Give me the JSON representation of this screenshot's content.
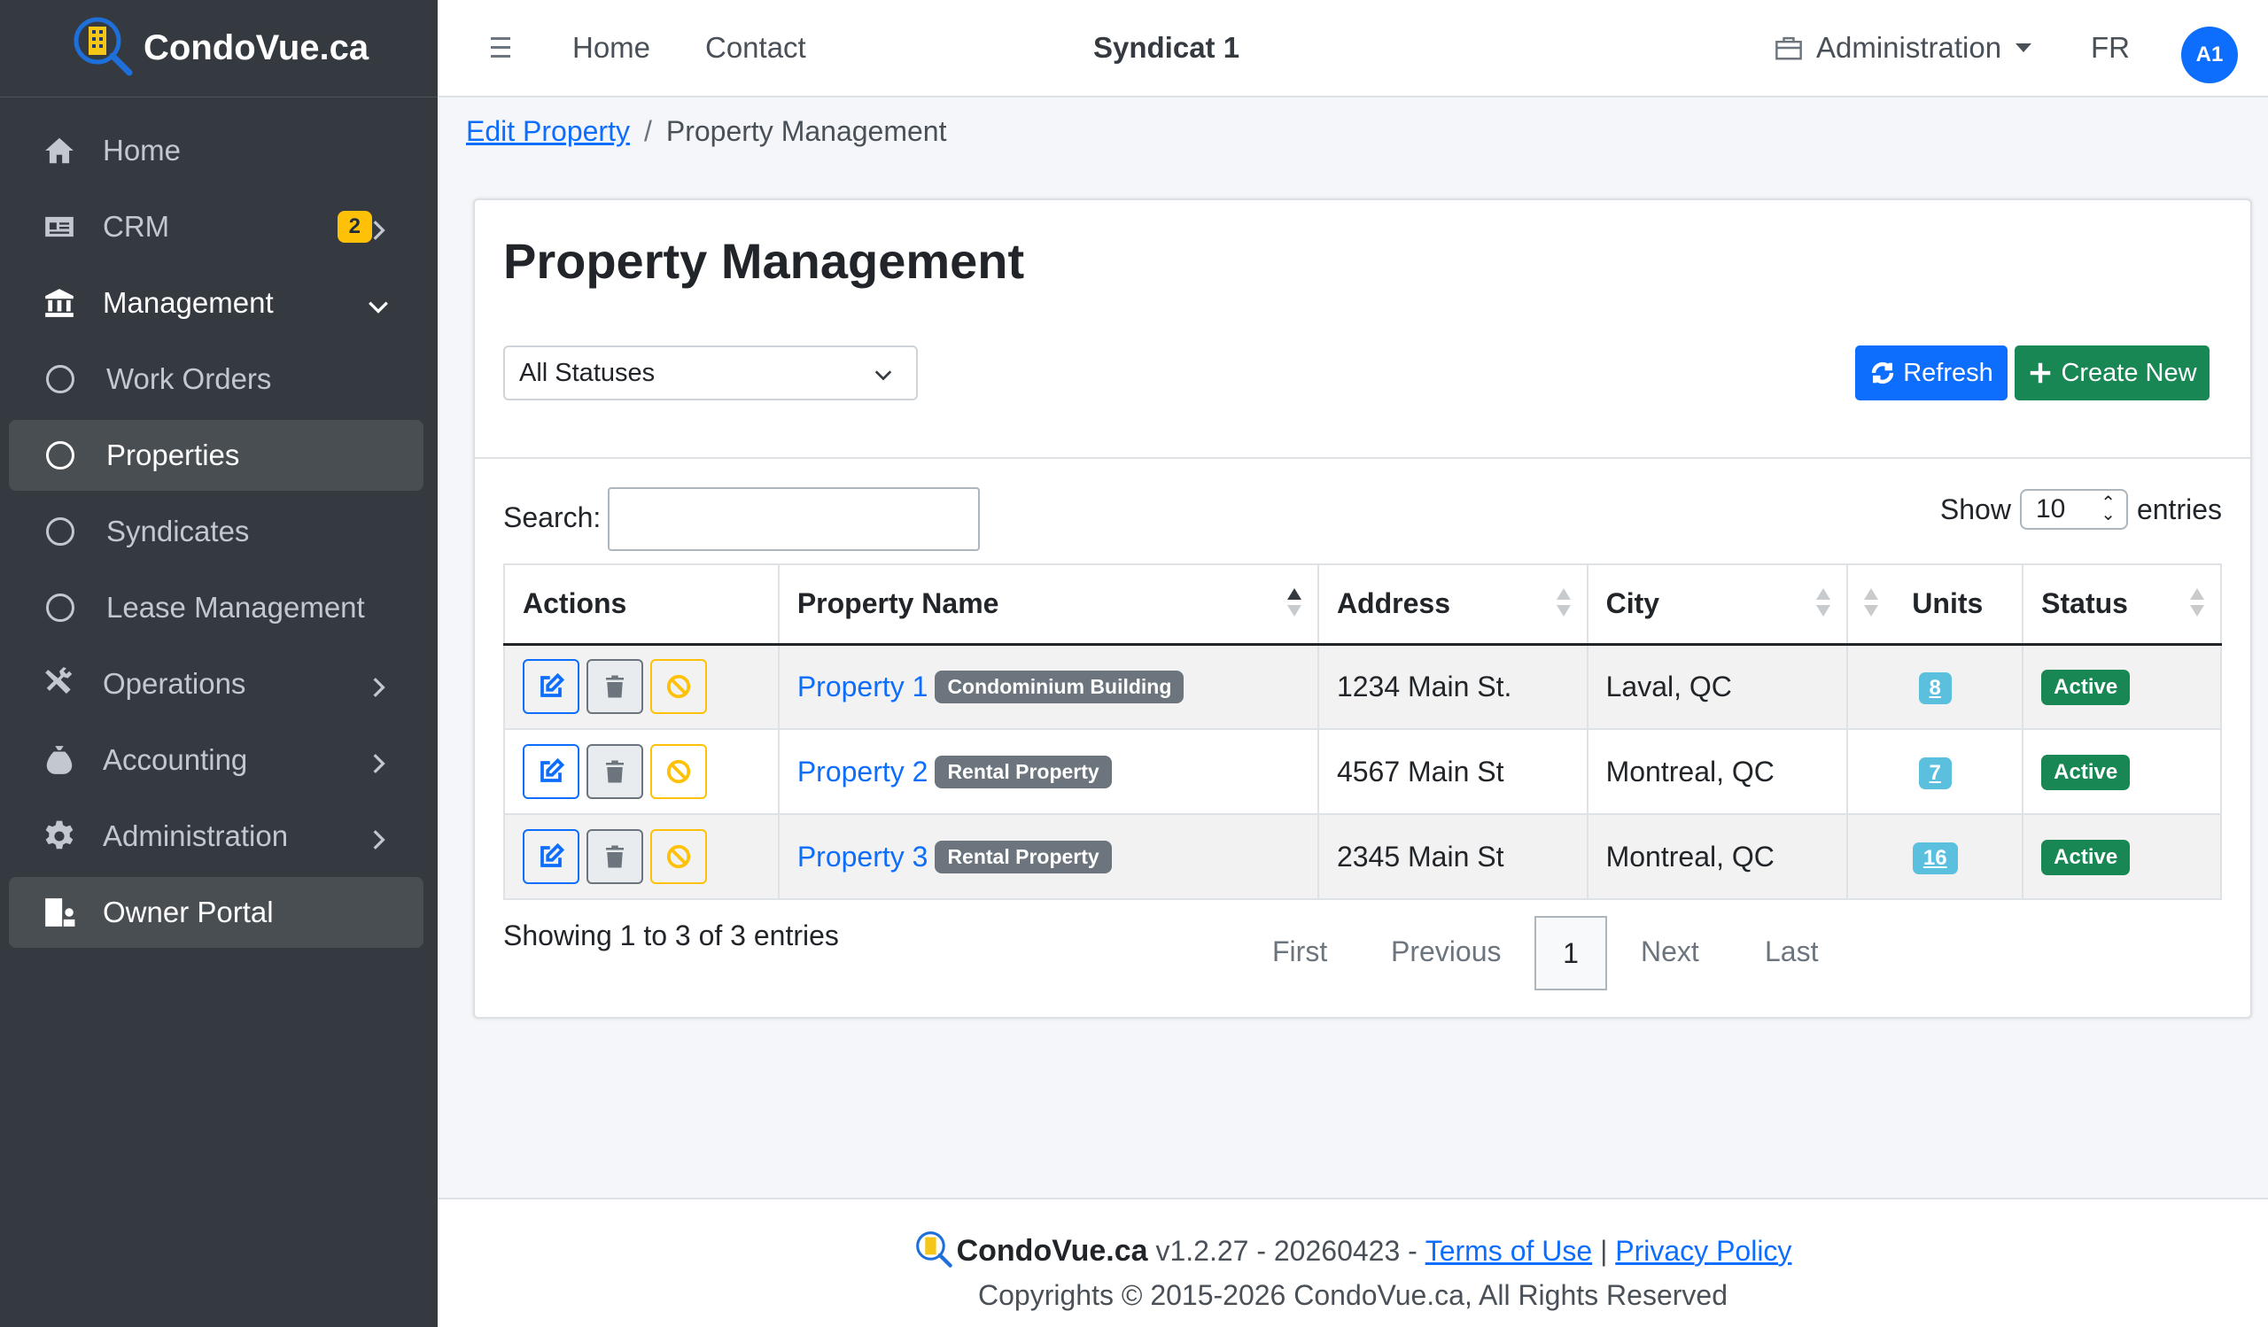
{
  "brand": {
    "name": "CondoVue.ca"
  },
  "sidebar": {
    "items": [
      {
        "label": "Home",
        "icon": "home-icon"
      },
      {
        "label": "CRM",
        "icon": "id-card-icon",
        "badge": "2"
      },
      {
        "label": "Management",
        "icon": "bank-icon"
      },
      {
        "label": "Work Orders",
        "icon": "circle-icon"
      },
      {
        "label": "Properties",
        "icon": "circle-icon"
      },
      {
        "label": "Syndicates",
        "icon": "circle-icon"
      },
      {
        "label": "Lease Management",
        "icon": "circle-icon"
      },
      {
        "label": "Operations",
        "icon": "tools-icon"
      },
      {
        "label": "Accounting",
        "icon": "money-bag-icon"
      },
      {
        "label": "Administration",
        "icon": "gear-icon"
      },
      {
        "label": "Owner Portal",
        "icon": "building-user-icon"
      }
    ]
  },
  "topbar": {
    "home": "Home",
    "contact": "Contact",
    "title": "Syndicat 1",
    "admin": "Administration",
    "lang": "FR",
    "avatar": "A1"
  },
  "breadcrumb": {
    "link": "Edit Property",
    "separator": "/",
    "current": "Property Management"
  },
  "card": {
    "title": "Property Management",
    "status_filter": "All Statuses",
    "refresh": "Refresh",
    "create": "Create New"
  },
  "table_controls": {
    "search_label": "Search:",
    "search_value": "",
    "show_label": "Show",
    "show_value": "10",
    "entries_label": "entries"
  },
  "table": {
    "headers": [
      "Actions",
      "Property Name",
      "Address",
      "City",
      "Units",
      "Status"
    ],
    "rows": [
      {
        "name": "Property 1",
        "type": "Condominium Building",
        "address": "1234 Main St.",
        "city": "Laval, QC",
        "units": "8",
        "status": "Active"
      },
      {
        "name": "Property 2",
        "type": "Rental Property",
        "address": "4567 Main St",
        "city": "Montreal, QC",
        "units": "7",
        "status": "Active"
      },
      {
        "name": "Property 3",
        "type": "Rental Property",
        "address": "2345 Main St",
        "city": "Montreal, QC",
        "units": "16",
        "status": "Active"
      }
    ]
  },
  "pagination": {
    "info": "Showing 1 to 3 of 3 entries",
    "first": "First",
    "previous": "Previous",
    "current": "1",
    "next": "Next",
    "last": "Last"
  },
  "footer": {
    "brand": "CondoVue.ca",
    "version": " v1.2.27 - 20260423 - ",
    "terms": "Terms of Use",
    "pipe": " | ",
    "privacy": "Privacy Policy",
    "copyright": "Copyrights © 2015-2026 CondoVue.ca, All Rights Reserved"
  },
  "colors": {
    "sidebar_bg": "#343a40",
    "primary": "#0d6efd",
    "success": "#198754",
    "warning": "#ffc107",
    "info": "#5bc0de",
    "secondary": "#6c757d"
  }
}
